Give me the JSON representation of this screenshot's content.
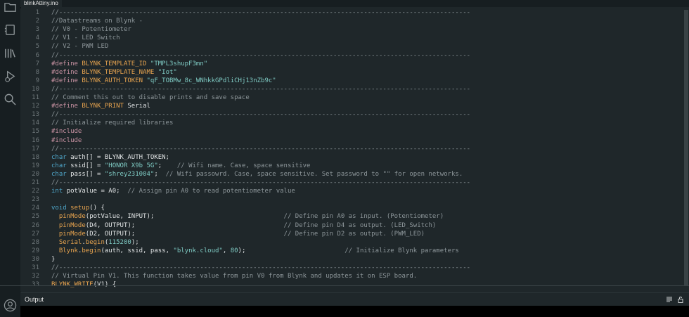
{
  "tab": {
    "label": "blinkAttiny.ino"
  },
  "icons": {
    "sidebar": [
      "folder-icon",
      "board-icon",
      "library-icon",
      "debug-icon",
      "search-icon"
    ],
    "profile": "profile-icon",
    "output_controls": [
      "list-icon",
      "lock-icon"
    ]
  },
  "colors": {
    "background": "#1f272a",
    "comment": "#8d969a",
    "preprocessor": "#c993a3",
    "macro": "#e8a44f",
    "string": "#7fcbc4",
    "type": "#4fa6c9"
  },
  "output": {
    "label": "Output"
  },
  "editor": {
    "lines": [
      {
        "num": "1",
        "tokens": [
          [
            "c",
            "//------------------------------------------------------------------------------------------------------------"
          ]
        ]
      },
      {
        "num": "2",
        "tokens": [
          [
            "c",
            "//Datastreams on Blynk -"
          ]
        ]
      },
      {
        "num": "3",
        "tokens": [
          [
            "c",
            "// V0 - Potentiometer"
          ]
        ]
      },
      {
        "num": "4",
        "tokens": [
          [
            "c",
            "// V1 - LED Switch"
          ]
        ]
      },
      {
        "num": "5",
        "tokens": [
          [
            "c",
            "// V2 - PWM LED"
          ]
        ]
      },
      {
        "num": "6",
        "tokens": [
          [
            "c",
            "//------------------------------------------------------------------------------------------------------------"
          ]
        ]
      },
      {
        "num": "7",
        "tokens": [
          [
            "p",
            "#define "
          ],
          [
            "m",
            "BLYNK_TEMPLATE_ID "
          ],
          [
            "s",
            "\"TMPL3shupF3mn\""
          ]
        ]
      },
      {
        "num": "8",
        "tokens": [
          [
            "p",
            "#define "
          ],
          [
            "m",
            "BLYNK_TEMPLATE_NAME "
          ],
          [
            "s",
            "\"Iot\""
          ]
        ]
      },
      {
        "num": "9",
        "tokens": [
          [
            "p",
            "#define "
          ],
          [
            "m",
            "BLYNK_AUTH_TOKEN "
          ],
          [
            "s",
            "\"qF_TOBMw_8c_WNhkkGPdliCHj13nZb9c\""
          ]
        ]
      },
      {
        "num": "10",
        "tokens": [
          [
            "c",
            "//------------------------------------------------------------------------------------------------------------"
          ]
        ]
      },
      {
        "num": "11",
        "tokens": [
          [
            "c",
            "// Comment this out to disable prints and save space"
          ]
        ]
      },
      {
        "num": "12",
        "tokens": [
          [
            "p",
            "#define "
          ],
          [
            "m",
            "BLYNK_PRINT "
          ],
          [
            "n",
            "Serial"
          ]
        ]
      },
      {
        "num": "13",
        "tokens": [
          [
            "c",
            "//------------------------------------------------------------------------------------------------------------"
          ]
        ]
      },
      {
        "num": "14",
        "tokens": [
          [
            "c",
            "// Initialize required libraries"
          ]
        ]
      },
      {
        "num": "15",
        "tokens": [
          [
            "p",
            "#include"
          ]
        ]
      },
      {
        "num": "16",
        "tokens": [
          [
            "p",
            "#include"
          ]
        ]
      },
      {
        "num": "17",
        "tokens": [
          [
            "c",
            "//------------------------------------------------------------------------------------------------------------"
          ]
        ]
      },
      {
        "num": "18",
        "tokens": [
          [
            "t",
            "char "
          ],
          [
            "n",
            "auth[] = BLYNK_AUTH_TOKEN;"
          ]
        ]
      },
      {
        "num": "19",
        "tokens": [
          [
            "t",
            "char "
          ],
          [
            "n",
            "ssid[] = "
          ],
          [
            "s",
            "\"HONOR X9b 5G\""
          ],
          [
            "n",
            ";    "
          ],
          [
            "c",
            "// Wifi name. Case, space sensitive"
          ]
        ]
      },
      {
        "num": "20",
        "tokens": [
          [
            "t",
            "char "
          ],
          [
            "n",
            "pass[] = "
          ],
          [
            "s",
            "\"shrey231004\""
          ],
          [
            "n",
            ";  "
          ],
          [
            "c",
            "// Wifi passowrd. Case, space sensitive. Set password to \"\" for open networks."
          ]
        ]
      },
      {
        "num": "21",
        "tokens": [
          [
            "c",
            "//------------------------------------------------------------------------------------------------------------"
          ]
        ]
      },
      {
        "num": "22",
        "tokens": [
          [
            "t",
            "int "
          ],
          [
            "n",
            "potValue = A0;  "
          ],
          [
            "c",
            "// Assign pin A0 to read potentiometer value"
          ]
        ]
      },
      {
        "num": "23",
        "tokens": []
      },
      {
        "num": "24",
        "tokens": [
          [
            "t",
            "void "
          ],
          [
            "f",
            "setup"
          ],
          [
            "n",
            "() {"
          ]
        ]
      },
      {
        "num": "25",
        "tokens": [
          [
            "n",
            "  "
          ],
          [
            "f",
            "pinMode"
          ],
          [
            "n",
            "(potValue, INPUT);                                  "
          ],
          [
            "c",
            "// Define pin A0 as input. (Potentiometer)"
          ]
        ]
      },
      {
        "num": "26",
        "tokens": [
          [
            "n",
            "  "
          ],
          [
            "f",
            "pinMode"
          ],
          [
            "n",
            "(D4, OUTPUT);                                       "
          ],
          [
            "c",
            "// Define pin D4 as output. (LED_Switch)"
          ]
        ]
      },
      {
        "num": "27",
        "tokens": [
          [
            "n",
            "  "
          ],
          [
            "f",
            "pinMode"
          ],
          [
            "n",
            "(D2, OUTPUT);                                       "
          ],
          [
            "c",
            "// Define pin D2 as output. (PWM_LED)"
          ]
        ]
      },
      {
        "num": "28",
        "tokens": [
          [
            "n",
            "  "
          ],
          [
            "f",
            "Serial"
          ],
          [
            "n",
            "."
          ],
          [
            "f",
            "begin"
          ],
          [
            "n",
            "("
          ],
          [
            "u",
            "115200"
          ],
          [
            "n",
            ");"
          ]
        ]
      },
      {
        "num": "29",
        "tokens": [
          [
            "n",
            "  "
          ],
          [
            "f",
            "Blynk"
          ],
          [
            "n",
            "."
          ],
          [
            "f",
            "begin"
          ],
          [
            "n",
            "(auth, ssid, pass, "
          ],
          [
            "s",
            "\"blynk.cloud\""
          ],
          [
            "n",
            ", "
          ],
          [
            "u",
            "80"
          ],
          [
            "n",
            ");                          "
          ],
          [
            "c",
            "// Initialize Blynk parameters"
          ]
        ]
      },
      {
        "num": "30",
        "tokens": [
          [
            "n",
            "}"
          ]
        ]
      },
      {
        "num": "31",
        "tokens": [
          [
            "c",
            "//------------------------------------------------------------------------------------------------------------"
          ]
        ]
      },
      {
        "num": "32",
        "tokens": [
          [
            "c",
            "// Virtual Pin V1. This function takes value from pin V0 from Blynk and updates it on ESP board."
          ]
        ]
      },
      {
        "num": "33",
        "tokens": [
          [
            "f",
            "BLYNK_WRITE"
          ],
          [
            "n",
            "(V1) {"
          ]
        ]
      }
    ]
  }
}
